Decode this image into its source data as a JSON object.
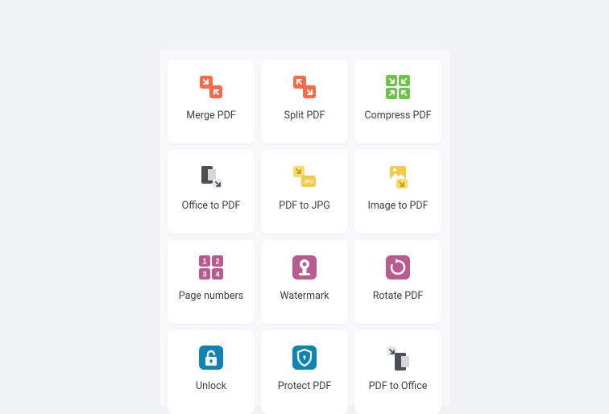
{
  "tools": [
    {
      "id": "merge",
      "label": "Merge PDF",
      "icon": "merge-icon"
    },
    {
      "id": "split",
      "label": "Split PDF",
      "icon": "split-icon"
    },
    {
      "id": "compress",
      "label": "Compress PDF",
      "icon": "compress-icon"
    },
    {
      "id": "office2pdf",
      "label": "Office to PDF",
      "icon": "office-to-pdf-icon"
    },
    {
      "id": "pdf2jpg",
      "label": "PDF to JPG",
      "icon": "pdf-to-jpg-icon"
    },
    {
      "id": "img2pdf",
      "label": "Image to PDF",
      "icon": "image-to-pdf-icon"
    },
    {
      "id": "pagenum",
      "label": "Page numbers",
      "icon": "page-numbers-icon"
    },
    {
      "id": "watermark",
      "label": "Watermark",
      "icon": "watermark-icon"
    },
    {
      "id": "rotate",
      "label": "Rotate PDF",
      "icon": "rotate-icon"
    },
    {
      "id": "unlock",
      "label": "Unlock",
      "icon": "unlock-icon"
    },
    {
      "id": "protect",
      "label": "Protect PDF",
      "icon": "protect-icon"
    },
    {
      "id": "pdf2office",
      "label": "PDF to Office",
      "icon": "pdf-to-office-icon"
    }
  ],
  "colors": {
    "orange": "#f96a4b",
    "green": "#6cc24a",
    "yellow": "#f7c948",
    "magenta": "#bb5a8e",
    "blue": "#1083b5",
    "grayDark": "#4a4f55",
    "grayLight": "#d4d6da"
  }
}
